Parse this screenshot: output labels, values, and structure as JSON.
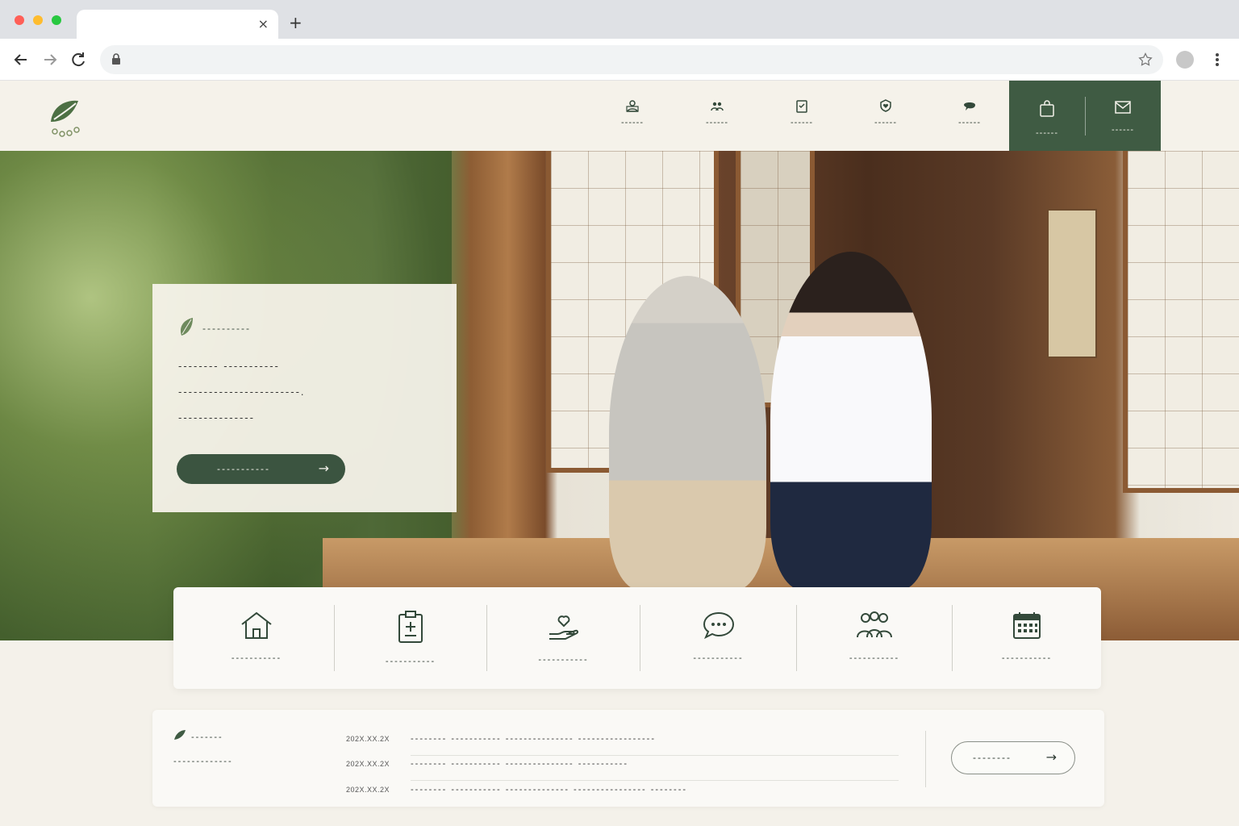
{
  "browser": {
    "tab_close": "×",
    "new_tab": "+"
  },
  "site": {
    "nav_items": [
      {
        "label": "------",
        "icon": "person-badge-icon"
      },
      {
        "label": "------",
        "icon": "care-people-icon"
      },
      {
        "label": "------",
        "icon": "clipboard-icon"
      },
      {
        "label": "------",
        "icon": "shield-heart-icon"
      },
      {
        "label": "------",
        "icon": "chat-bubble-icon"
      }
    ],
    "cta_items": [
      {
        "label": "------",
        "icon": "bag-icon"
      },
      {
        "label": "------",
        "icon": "mail-icon"
      }
    ]
  },
  "hero": {
    "eyebrow": "----------",
    "lines": [
      "--------  -----------",
      "------------------------.",
      "---------------"
    ],
    "button_label": "-----------",
    "button_arrow": "→"
  },
  "services": [
    {
      "label": "-----------",
      "icon": "home-icon"
    },
    {
      "label": "-----------",
      "icon": "clipboard-plus-icon"
    },
    {
      "label": "-----------",
      "icon": "hand-heart-icon"
    },
    {
      "label": "-----------",
      "icon": "speech-bubble-icon"
    },
    {
      "label": "-----------",
      "icon": "group-icon"
    },
    {
      "label": "-----------",
      "icon": "calendar-icon"
    }
  ],
  "news": {
    "title": "-------",
    "subtitle": "-------------",
    "items": [
      {
        "date": "202X.XX.2X",
        "text": "-------- ----------- --------------- -----------------"
      },
      {
        "date": "202X.XX.2X",
        "text": "-------- ----------- --------------- -----------"
      },
      {
        "date": "202X.XX.2X",
        "text": "-------- ----------- -------------- ---------------- --------"
      }
    ],
    "button_label": "--------",
    "button_arrow": "→"
  },
  "colors": {
    "brand_green": "#3f5b43",
    "cream": "#f5f2ea",
    "panel": "#faf9f6"
  }
}
